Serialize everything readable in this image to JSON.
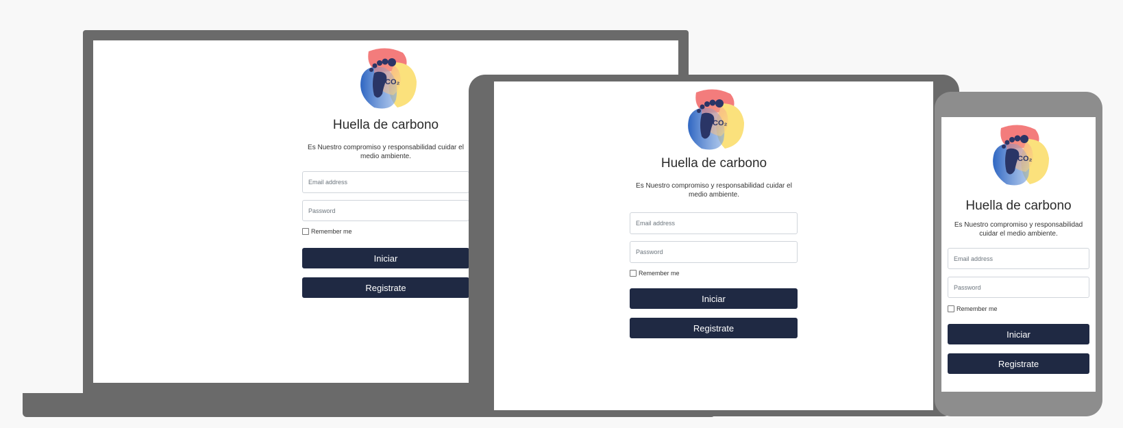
{
  "login": {
    "title": "Huella de carbono",
    "description": "Es Nuestro compromiso y responsabilidad cuidar el medio ambiente.",
    "email_placeholder": "Email address",
    "password_placeholder": "Password",
    "remember_label": "Remember me",
    "remember_checked": false,
    "login_button": "Iniciar",
    "register_button": "Registrate",
    "logo_text": "CO₂",
    "logo_icon": "footprint-co2-icon"
  },
  "devices": [
    "laptop",
    "tablet",
    "phone"
  ],
  "colors": {
    "background": "#f8f8f8",
    "device_frame": "#6a6a6a",
    "phone_frame": "#8d8d8d",
    "button": "#1f2943",
    "footprint": "#2a3566",
    "blob_blue": "#3d73c4",
    "blob_red": "#f37c7c",
    "blob_yellow": "#fbe17c"
  }
}
